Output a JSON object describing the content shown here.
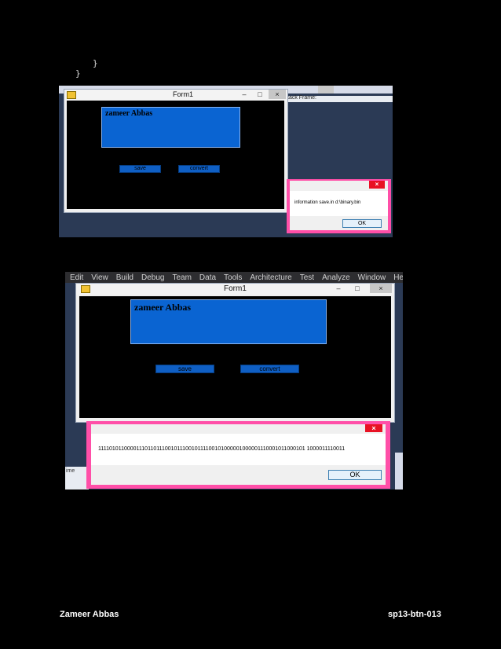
{
  "code_lines": [
    "}",
    "}"
  ],
  "shot1": {
    "ide_tab": "tack Frame:",
    "form_title": "Form1",
    "name_text": "zameer Abbas",
    "save_label": "save",
    "convert_label": "convert",
    "message": "information save.in d:\\binary.bin",
    "ok_label": "OK",
    "close_glyph": "×",
    "min_glyph": "–",
    "max_glyph": "□"
  },
  "shot2": {
    "menu": [
      "Edit",
      "View",
      "Build",
      "Debug",
      "Team",
      "Data",
      "Tools",
      "Architecture",
      "Test",
      "Analyze",
      "Window",
      "Help"
    ],
    "form_title": "Form1",
    "name_text": "zameer Abbas",
    "save_label": "save",
    "convert_label": "convert",
    "message": "1111010110000111011011100101110010111100101000001000001110001011000101 1000011110011",
    "ok_label": "OK",
    "side_label": "ime",
    "close_glyph": "×",
    "min_glyph": "–",
    "max_glyph": "□"
  },
  "footer": {
    "author": "Zameer  Abbas",
    "id": "sp13-btn-013"
  }
}
